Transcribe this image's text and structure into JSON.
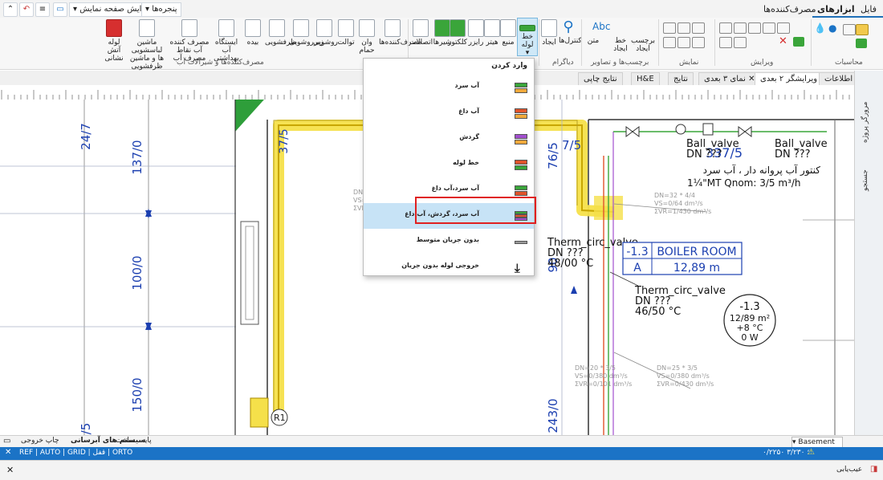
{
  "menubar": {
    "tabs": [
      "فایل",
      "ابزارهای اصلی",
      "مصرف‌کننده‌ها"
    ],
    "active_tab": "ابزارهای اصلی",
    "windows_dropdown": "پنجره‌ها",
    "layout_dropdown": "تغییر آرایش صفحه نمایش"
  },
  "ribbon": {
    "groups": {
      "calculations": "محاسبات",
      "edit": "ویرایش",
      "display": "نمایش",
      "labels_images": "برچسب‌ها و تصاویر",
      "diagram": "دیاگرام",
      "consumers_fittings": "مصرف‌کننده‌ها و شیرآلات آب"
    },
    "buttons": {
      "pipe_line": "خط\nلوله",
      "source": "منبع",
      "heater": "هیتر",
      "riser": "رایزر",
      "collector": "کلکتور",
      "valves": "شیرها",
      "connections": "اتصالات",
      "consumers": "مصرف‌کننده‌ها",
      "bathtub": "وان\nحمام",
      "toilet": "توالت",
      "washbasin": "روشویی",
      "under_washbasin": "زیرروشویی",
      "dishwasher": "ظرفشویی",
      "bidet": "بیده",
      "sanitary_station": "ایستگاه آب\nبهداشتی",
      "consumer_point": "مصرف کننده آب\nنقاط مصرف آب",
      "washing_machine": "ماشین لباسشویی ها و\nماشین ظرفشویی",
      "fire_hose": "لوله آتش\nنشانی",
      "control": "کنترل‌ها",
      "create": "ایجاد",
      "label_text": "متن",
      "abc": "Abc",
      "line_create": "خط\nایجاد",
      "label": "برچسب\nایجاد"
    }
  },
  "document_tabs": [
    "اطلاعات کلی",
    "ویرایشگر ۲ بعدی",
    "نمای ۳ بعدی",
    "نتایج",
    "H&E",
    "نتایج چاپی"
  ],
  "active_doc_tab": "ویرایشگر ۲ بعدی",
  "side_panel_tabs": [
    "مرورگر پروژه",
    "جستجو"
  ],
  "dropdown": {
    "title": "وارد کردن",
    "items": [
      {
        "label": "آب سرد",
        "colors": [
          "#3aa53a",
          "#f2a93b"
        ]
      },
      {
        "label": "آب داغ",
        "colors": [
          "#e0532b",
          "#f2a93b"
        ]
      },
      {
        "label": "گردش",
        "colors": [
          "#a24fcf",
          "#f2a93b"
        ]
      },
      {
        "label": "خط لوله",
        "colors": [
          "#e0532b",
          "#3aa53a"
        ]
      },
      {
        "label": "آب سرد،آب داغ",
        "colors": [
          "#3aa53a",
          "#e0532b"
        ]
      },
      {
        "label": "آب سرد، گردش، آب داغ",
        "colors": [
          "#3aa53a",
          "#e0532b",
          "#a24fcf"
        ],
        "selected": true
      },
      {
        "label": "بدون جریان متوسط",
        "colors": [
          "#999999"
        ]
      },
      {
        "label": "خروجی لوله بدون جریان",
        "icon": "download-icon"
      }
    ]
  },
  "drawing": {
    "dimensions": {
      "d247": "24/7",
      "d1370": "137/0",
      "d1000": "100/0",
      "d1500": "150/0",
      "d5": "/5",
      "d765": "76/5",
      "d2430": "243/0",
      "d3370": "337/5",
      "d375": "37/5",
      "d75": "7/5",
      "d90": "90"
    },
    "labels": {
      "ball_valve_1": "Ball_valve",
      "ball_valve_1_dn": "DN ???",
      "ball_valve_2": "Ball_valve",
      "ball_valve_2_dn": "DN ???",
      "meter_persian": "کنتور آب پروانه دار ، آب سرد",
      "meter_spec": "1¼\"MT Qnom: 3/5 m³/h",
      "therm1": "Therm_circ_valve",
      "therm1_dn": "DN ???",
      "therm1_temp": "48/00 °C",
      "therm2": "Therm_circ_valve",
      "therm2_dn": "DN ???",
      "therm2_temp": "46/50 °C",
      "room_level": "-1.3",
      "room_name": "BOILER ROOM",
      "room_letter": "A",
      "room_area": "12,89 m",
      "circle_level": "-1.3",
      "circle_area": "12/89 m²",
      "circle_temp": "+8 °C",
      "circle_power": "0 W",
      "r1": "R1",
      "dn32": "DN=32 * 4/4",
      "vs1": "VS=0/64 dm³/s",
      "vr1": "ΣVR=1/430 dm³/s",
      "dn20": "DN=20 * 3/5",
      "vs2": "VS=0/380 dm³/s",
      "vr2": "ΣVR=0/101 dm³/s",
      "dn25": "DN=25 * 3/5",
      "vs3": "VS=0/380 dm³/s",
      "vr3": "ΣVR=0/430 dm³/s",
      "dn_small": "DN",
      "vs_small": "VS=",
      "vr_small": "ΣVR="
    }
  },
  "layout_tabs": {
    "print_output": "چاپ خروجی",
    "hydraulic_system": "سیستم های آبرسانی",
    "building": "ساخت",
    "base": "پایه",
    "basement": "Basement"
  },
  "status": {
    "modes": "REF | AUTO | GRID | قفل | ORTO",
    "coords": "۰/۲۲۵۰ ؛ ۳/۲۳۰",
    "errors_label": "عیب‌یابی"
  },
  "colors": {
    "accent": "#1b73c6",
    "highlight_yellow": "#f5e04a",
    "selection_red": "#e02020"
  }
}
